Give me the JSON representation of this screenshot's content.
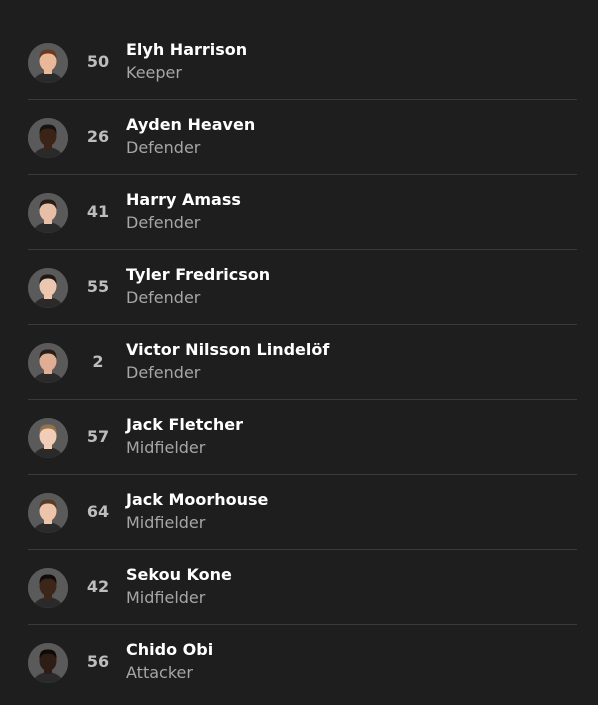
{
  "players": [
    {
      "number": "50",
      "name": "Elyh Harrison",
      "position": "Keeper",
      "skin": "#e8b898",
      "hair": "#6b3a1e"
    },
    {
      "number": "26",
      "name": "Ayden Heaven",
      "position": "Defender",
      "skin": "#3a2418",
      "hair": "#1a120c"
    },
    {
      "number": "41",
      "name": "Harry Amass",
      "position": "Defender",
      "skin": "#e6bfa6",
      "hair": "#2a1d16"
    },
    {
      "number": "55",
      "name": "Tyler Fredricson",
      "position": "Defender",
      "skin": "#ecc7b0",
      "hair": "#1f1814"
    },
    {
      "number": "2",
      "name": "Victor Nilsson Lindelöf",
      "position": "Defender",
      "skin": "#dfae94",
      "hair": "#2b1d14"
    },
    {
      "number": "57",
      "name": "Jack Fletcher",
      "position": "Midfielder",
      "skin": "#f0cdb6",
      "hair": "#9a7048"
    },
    {
      "number": "64",
      "name": "Jack Moorhouse",
      "position": "Midfielder",
      "skin": "#ecc4aa",
      "hair": "#5a3a22"
    },
    {
      "number": "42",
      "name": "Sekou Kone",
      "position": "Midfielder",
      "skin": "#3b2619",
      "hair": "#120c08"
    },
    {
      "number": "56",
      "name": "Chido Obi",
      "position": "Attacker",
      "skin": "#2e1d14",
      "hair": "#0e0a08"
    }
  ]
}
